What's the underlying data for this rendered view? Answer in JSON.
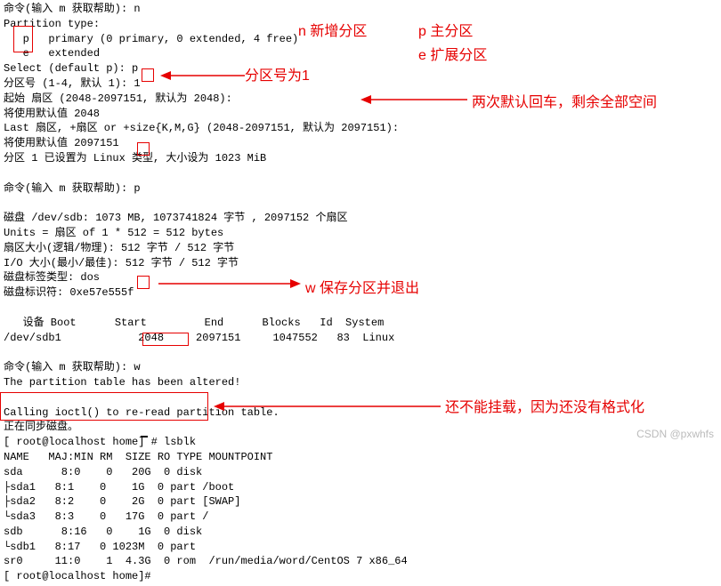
{
  "terminal": {
    "l1": "命令(输入 m 获取帮助): n",
    "l2": "Partition type:",
    "l3": "   p   primary (0 primary, 0 extended, 4 free)",
    "l4": "   e   extended",
    "l5": "Select (default p): p",
    "l6": "分区号 (1-4, 默认 1): 1",
    "l7": "起始 扇区 (2048-2097151, 默认为 2048):",
    "l8": "将使用默认值 2048",
    "l9": "Last 扇区, +扇区 or +size{K,M,G} (2048-2097151, 默认为 2097151):",
    "l10": "将使用默认值 2097151",
    "l11": "分区 1 已设置为 Linux 类型, 大小设为 1023 MiB",
    "l12": "",
    "l13": "命令(输入 m 获取帮助): p",
    "l14": "",
    "l15": "磁盘 /dev/sdb: 1073 MB, 1073741824 字节 , 2097152 个扇区",
    "l16": "Units = 扇区 of 1 * 512 = 512 bytes",
    "l17": "扇区大小(逻辑/物理): 512 字节 / 512 字节",
    "l18": "I/O 大小(最小/最佳): 512 字节 / 512 字节",
    "l19": "磁盘标签类型: dos",
    "l20": "磁盘标识符: 0xe57e555f",
    "l21": "",
    "l22": "   设备 Boot      Start         End      Blocks   Id  System",
    "l23": "/dev/sdb1            2048     2097151     1047552   83  Linux",
    "l24": "",
    "l25": "命令(输入 m 获取帮助): w",
    "l26": "The partition table has been altered!",
    "l27": "",
    "l28": "Calling ioctl() to re-read partition table.",
    "l29": "正在同步磁盘。",
    "l30": "[ root@localhost home] # lsblk",
    "l31": "NAME   MAJ:MIN RM  SIZE RO TYPE MOUNTPOINT",
    "l32": "sda      8:0    0   20G  0 disk",
    "l33": "├sda1   8:1    0    1G  0 part /boot",
    "l34": "├sda2   8:2    0    2G  0 part [SWAP]",
    "l35": "└sda3   8:3    0   17G  0 part /",
    "l36": "sdb      8:16   0    1G  0 disk",
    "l37": "└sdb1   8:17   0 1023M  0 part",
    "l38": "sr0     11:0    1  4.3G  0 rom  /run/media/word/CentOS 7 x86_64",
    "l39": "[ root@localhost home]#"
  },
  "annotations": {
    "a1": "n 新增分区",
    "a2": "p 主分区",
    "a3": "e 扩展分区",
    "a4": "分区号为1",
    "a5": "两次默认回车，剩余全部空间",
    "a6": "w 保存分区并退出",
    "a7": "还不能挂载，因为还没有格式化"
  },
  "watermark": "CSDN @pxwhfs"
}
